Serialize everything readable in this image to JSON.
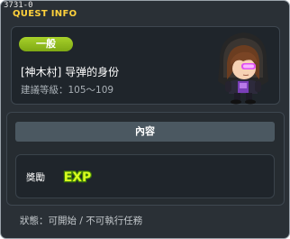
{
  "window": {
    "quest_id": "3731-0",
    "title": "QUEST INFO"
  },
  "quest": {
    "category_badge": "一般",
    "name": "[神木村] 导弹的身份",
    "level_label": "建議等級",
    "level_range": "105～109"
  },
  "content": {
    "header": "內容",
    "reward_label": "獎勵",
    "reward_icon": "EXP"
  },
  "status": {
    "label": "狀態",
    "value": "可開始 / 不可執行任務"
  },
  "colors": {
    "title": "#ffd23c",
    "badge": "#93bf1f",
    "exp_text": "#d8ff1e",
    "panel": "#2a3036"
  },
  "icons": {
    "npc": "hooded-npc-portrait",
    "reward": "exp-icon"
  }
}
